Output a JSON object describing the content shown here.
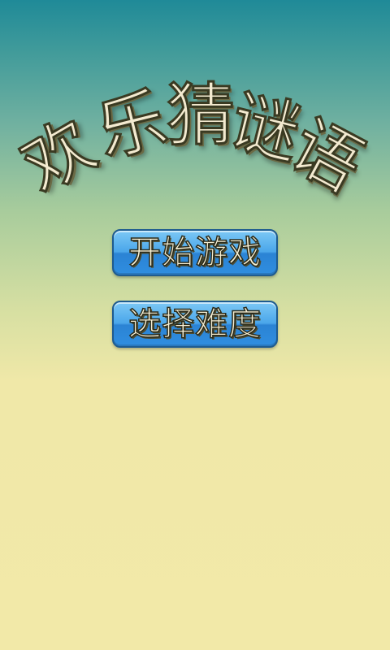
{
  "title": {
    "chars": [
      "欢",
      "乐",
      "猜",
      "谜",
      "语"
    ]
  },
  "menu": {
    "start_label": "开始游戏",
    "difficulty_label": "选择难度"
  },
  "colors": {
    "background_top": "#1f8a98",
    "background_bottom": "#f2e9a8",
    "button_blue": "#3a95e2",
    "title_text": "#f3ead0"
  }
}
